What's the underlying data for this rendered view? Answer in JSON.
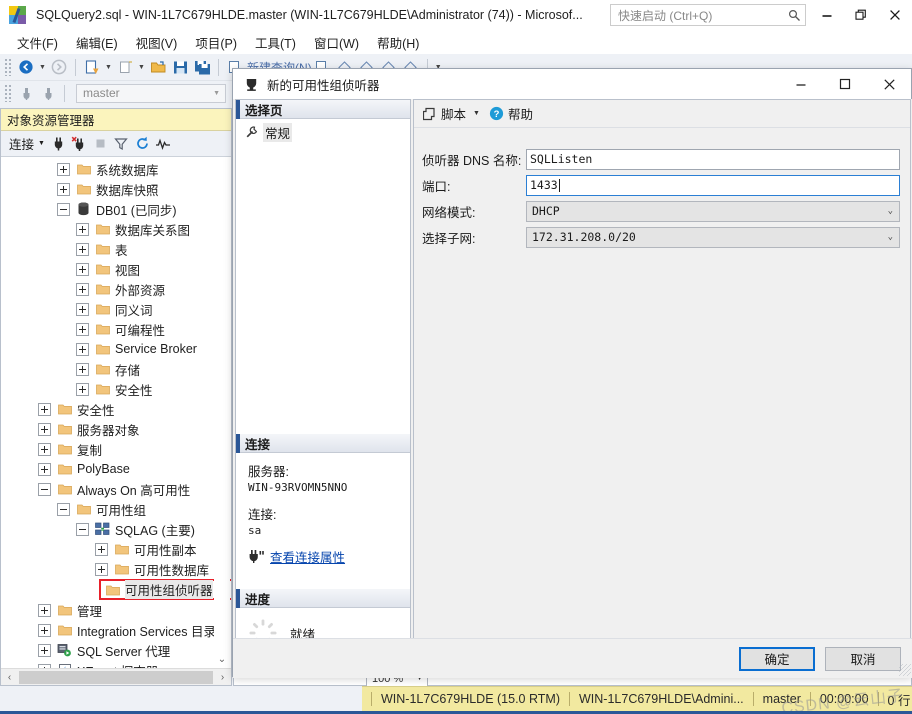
{
  "window": {
    "title": "SQLQuery2.sql - WIN-1L7C679HLDE.master (WIN-1L7C679HLDE\\Administrator (74)) - Microsof...",
    "app_icon": "ssms-logo-icon",
    "minimize": "–",
    "restore": "❐",
    "close": "✕"
  },
  "quick_launch": {
    "placeholder": "快速启动 (Ctrl+Q)",
    "icon": "search-icon"
  },
  "menu": {
    "items": [
      {
        "label": "文件(F)"
      },
      {
        "label": "编辑(E)"
      },
      {
        "label": "视图(V)"
      },
      {
        "label": "项目(P)"
      },
      {
        "label": "工具(T)"
      },
      {
        "label": "窗口(W)"
      },
      {
        "label": "帮助(H)"
      }
    ]
  },
  "toolbar": {
    "database_combo_value": "master",
    "caret": "▾",
    "buttons": [
      {
        "name": "navigate-back-icon"
      },
      {
        "name": "navigate-forward-icon"
      },
      {
        "name": "new-query-icon"
      },
      {
        "name": "new-query-template-icon"
      },
      {
        "name": "open-file-icon"
      },
      {
        "name": "save-icon"
      },
      {
        "name": "save-all-icon"
      }
    ]
  },
  "object_explorer": {
    "header": "对象资源管理器",
    "connect_label": "连接",
    "toolbar_icons": [
      "connect-icon",
      "disconnect-icon",
      "stop-icon",
      "filter-icon",
      "refresh-icon",
      "activity-monitor-icon"
    ],
    "tree": [
      {
        "label": "系统数据库",
        "indent": 2,
        "expander": "plus",
        "icon": "folder-icon"
      },
      {
        "label": "数据库快照",
        "indent": 2,
        "expander": "plus",
        "icon": "folder-icon"
      },
      {
        "label": "DB01 (已同步)",
        "indent": 2,
        "expander": "minus",
        "icon": "database-icon"
      },
      {
        "label": "数据库关系图",
        "indent": 3,
        "expander": "plus",
        "icon": "folder-icon"
      },
      {
        "label": "表",
        "indent": 3,
        "expander": "plus",
        "icon": "folder-icon"
      },
      {
        "label": "视图",
        "indent": 3,
        "expander": "plus",
        "icon": "folder-icon"
      },
      {
        "label": "外部资源",
        "indent": 3,
        "expander": "plus",
        "icon": "folder-icon"
      },
      {
        "label": "同义词",
        "indent": 3,
        "expander": "plus",
        "icon": "folder-icon"
      },
      {
        "label": "可编程性",
        "indent": 3,
        "expander": "plus",
        "icon": "folder-icon"
      },
      {
        "label": "Service Broker",
        "indent": 3,
        "expander": "plus",
        "icon": "folder-icon"
      },
      {
        "label": "存储",
        "indent": 3,
        "expander": "plus",
        "icon": "folder-icon"
      },
      {
        "label": "安全性",
        "indent": 3,
        "expander": "plus",
        "icon": "folder-icon"
      },
      {
        "label": "安全性",
        "indent": 1,
        "expander": "plus",
        "icon": "folder-icon"
      },
      {
        "label": "服务器对象",
        "indent": 1,
        "expander": "plus",
        "icon": "folder-icon"
      },
      {
        "label": "复制",
        "indent": 1,
        "expander": "plus",
        "icon": "folder-icon"
      },
      {
        "label": "PolyBase",
        "indent": 1,
        "expander": "plus",
        "icon": "folder-icon"
      },
      {
        "label": "Always On 高可用性",
        "indent": 1,
        "expander": "minus",
        "icon": "folder-icon"
      },
      {
        "label": "可用性组",
        "indent": 2,
        "expander": "minus",
        "icon": "folder-icon"
      },
      {
        "label": "SQLAG (主要)",
        "indent": 3,
        "expander": "minus",
        "icon": "availability-group-icon"
      },
      {
        "label": "可用性副本",
        "indent": 4,
        "expander": "plus",
        "icon": "folder-icon"
      },
      {
        "label": "可用性数据库",
        "indent": 4,
        "expander": "plus",
        "icon": "folder-icon"
      }
    ],
    "selected_node": {
      "label": "可用性组侦听器",
      "icon": "folder-icon",
      "highlight_color": "#e8202a"
    },
    "tree_tail": [
      {
        "label": "管理",
        "indent": 1,
        "expander": "plus",
        "icon": "folder-icon"
      },
      {
        "label": "Integration Services 目录",
        "indent": 1,
        "expander": "plus",
        "icon": "folder-icon"
      },
      {
        "label": "SQL Server 代理",
        "indent": 1,
        "expander": "plus",
        "icon": "sql-agent-icon"
      },
      {
        "label": "XEvent 探查器",
        "indent": 1,
        "expander": "plus",
        "icon": "xevent-icon"
      }
    ]
  },
  "editor": {
    "zoom_level": "100 %"
  },
  "status_bar": {
    "server": "WIN-1L7C679HLDE (15.0 RTM)",
    "user": "WIN-1L7C679HLDE\\Admini...",
    "database": "master",
    "elapsed": "00:00:00",
    "rows": "0 行",
    "watermark": "CSDN @云山子"
  },
  "dialog": {
    "title": "新的可用性组侦听器",
    "title_icon": "listener-icon",
    "minimize": "–",
    "maximize": "❐",
    "close": "✕",
    "select_page": {
      "header": "选择页",
      "items": [
        {
          "label": "常规",
          "icon": "wrench-icon",
          "selected": true
        }
      ]
    },
    "connection": {
      "header": "连接",
      "server_label": "服务器:",
      "server_value": "WIN-93RVOMN5NNO",
      "conn_label": "连接:",
      "conn_value": "sa",
      "properties_link": "查看连接属性",
      "link_icon": "connection-icon"
    },
    "progress": {
      "header": "进度",
      "status": "就绪",
      "spinner_icon": "spinner-icon"
    },
    "toolbar": {
      "script_label": "脚本",
      "script_icon": "script-icon",
      "script_caret": "▾",
      "help_label": "帮助",
      "help_icon": "help-icon"
    },
    "form": {
      "fields": [
        {
          "label": "侦听器 DNS 名称:",
          "value": "SQLListen",
          "type": "text",
          "focused": false
        },
        {
          "label": "端口:",
          "value": "1433",
          "type": "text",
          "focused": true
        },
        {
          "label": "网络模式:",
          "value": "DHCP",
          "type": "combo"
        },
        {
          "label": "选择子网:",
          "value": "172.31.208.0/20",
          "type": "combo"
        }
      ],
      "combo_caret": "⌄"
    },
    "footer": {
      "ok_label": "确定",
      "cancel_label": "取消"
    }
  }
}
